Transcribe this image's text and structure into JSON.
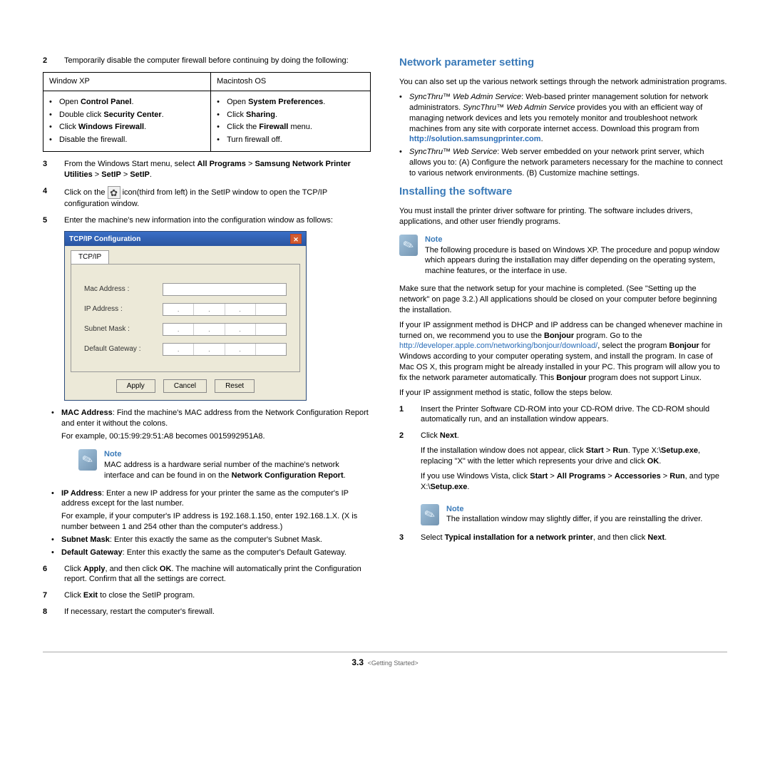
{
  "left": {
    "step2": "Temporarily disable the computer firewall before continuing by doing the following:",
    "table": {
      "h1": "Window XP",
      "h2": "Macintosh OS",
      "xp1a": "Open ",
      "xp1b": "Control Panel",
      "xp1c": ".",
      "xp2a": "Double click ",
      "xp2b": "Security Center",
      "xp2c": ".",
      "xp3a": "Click ",
      "xp3b": "Windows Firewall",
      "xp3c": ".",
      "xp4": "Disable the firewall.",
      "mac1a": "Open ",
      "mac1b": "System Preferences",
      "mac1c": ".",
      "mac2a": "Click ",
      "mac2b": "Sharing",
      "mac2c": ".",
      "mac3a": "Click the ",
      "mac3b": "Firewall",
      "mac3c": " menu.",
      "mac4": "Turn firewall off."
    },
    "step3a": "From the Windows Start menu, select ",
    "step3b": "All Programs",
    "step3c": " > ",
    "step3d": "Samsung Network Printer Utilities",
    "step3e": " > ",
    "step3f": "SetIP",
    "step3g": " > ",
    "step3h": "SetIP",
    "step3i": ".",
    "step4a": "Click on the  ",
    "step4b": " icon(third from left) in the SetIP window to open the TCP/IP configuration window.",
    "step5": "Enter the machine's new information into the configuration window as follows:",
    "dlg": {
      "title": "TCP/IP Configuration",
      "tab": "TCP/IP",
      "mac": "Mac Address :",
      "ip": "IP Address :",
      "subnet": "Subnet Mask :",
      "gw": "Default Gateway :",
      "apply": "Apply",
      "cancel": "Cancel",
      "reset": "Reset"
    },
    "macPost1a": "MAC Address",
    "macPost1b": ": Find the machine's MAC address from the Network Configuration Report and enter it without the colons.",
    "macPost2": "For example, 00:15:99:29:51:A8 becomes 0015992951A8.",
    "noteLabel": "Note",
    "note1a": "MAC address is a hardware serial number of the machine's network interface and can be found in on the ",
    "note1b": "Network Configuration Report",
    "note1c": ".",
    "ipPost1a": "IP Address",
    "ipPost1b": ": Enter a new IP address for your printer the same as the computer's IP address except for the last number.",
    "ipPost2": "For example, if your computer's IP address is 192.168.1.150, enter 192.168.1.X. (X is number between 1 and 254 other than the computer's address.)",
    "snPost1a": "Subnet Mask",
    "snPost1b": ": Enter this exactly the same as the computer's Subnet Mask.",
    "gwPost1a": "Default Gateway",
    "gwPost1b": ": Enter this exactly the same as the computer's Default Gateway.",
    "step6a": "Click ",
    "step6b": "Apply",
    "step6c": ", and then click ",
    "step6d": "OK",
    "step6e": ". The machine will automatically print the Configuration report. Confirm that all the settings are correct.",
    "step7a": "Click ",
    "step7b": "Exit",
    "step7c": " to close the SetIP program.",
    "step8": "If necessary, restart the computer's firewall."
  },
  "right": {
    "h1": "Network parameter setting",
    "p1": "You can also set up the various network settings through the network administration programs.",
    "svc1a": "SyncThru™ Web Admin Service",
    "svc1b": ": Web-based printer management solution for network administrators. ",
    "svc1c": "SyncThru™ Web Admin Service",
    "svc1d": " provides you with an efficient way of managing network devices and lets you remotely monitor and troubleshoot network machines from any site with corporate internet access. Download this program from ",
    "svc1link": "http://solution.samsungprinter.com",
    "svc1e": ".",
    "svc2a": "SyncThru™ Web Service",
    "svc2b": ": Web server embedded on your network print server, which allows you to: (A) Configure the network parameters necessary for the machine to connect to various network environments. (B) Customize machine settings.",
    "h2": "Installing the software",
    "p2": "You must install the printer driver software for printing. The software includes drivers, applications, and other user friendly programs.",
    "note1Label": "Note",
    "note1Text": "The following procedure is based on Windows XP. The procedure and popup window which appears during the installation may differ depending on the operating system, machine features, or the interface in use.",
    "p3": "Make sure that the network setup for your machine is completed. (See \"Setting up the network\" on page 3.2.) All applications should be closed on your computer before beginning the installation.",
    "p4a": "If your IP assignment method is DHCP and IP address can be changed whenever machine in turned on, we recommend you to use the ",
    "p4b": "Bonjour",
    "p4c": " program. Go to the ",
    "p4link": "http://developer.apple.com/networking/bonjour/download/",
    "p4d": ", select the program ",
    "p4e": "Bonjour",
    "p4f": " for Windows according to your computer operating system, and install the program. In case of Mac OS X, this program might be already installed in your PC. This program will allow you to fix the network parameter automatically. This ",
    "p4g": "Bonjour",
    "p4h": " program does not support Linux.",
    "p5": "If your IP assignment method is static, follow the steps below.",
    "r1": "Insert the Printer Software CD-ROM into your CD-ROM drive. The CD-ROM should automatically run, and an installation window appears.",
    "r2a": "Click ",
    "r2b": "Next",
    "r2c": ".",
    "r2p2a": "If the installation window does not appear, click ",
    "r2p2b": "Start",
    "r2p2c": " > ",
    "r2p2d": "Run",
    "r2p2e": ". Type X:\\",
    "r2p2f": "Setup.exe",
    "r2p2g": ", replacing \"X\" with the letter which represents your drive and click ",
    "r2p2h": "OK",
    "r2p2i": ".",
    "r2p3a": "If you use Windows Vista, click ",
    "r2p3b": "Start",
    "r2p3c": " > ",
    "r2p3d": "All Programs",
    "r2p3e": " > ",
    "r2p3f": "Accessories",
    "r2p3g": " > ",
    "r2p3h": "Run",
    "r2p3i": ", and type X:\\",
    "r2p3j": "Setup.exe",
    "r2p3k": ".",
    "note2Label": "Note",
    "note2Text": "The installation window may slightly differ, if you are reinstalling the driver.",
    "r3a": "Select ",
    "r3b": "Typical installation for a network printer",
    "r3c": ", and then click ",
    "r3d": "Next",
    "r3e": "."
  },
  "footer": {
    "page": "3.3",
    "caption": "<Getting Started>"
  }
}
